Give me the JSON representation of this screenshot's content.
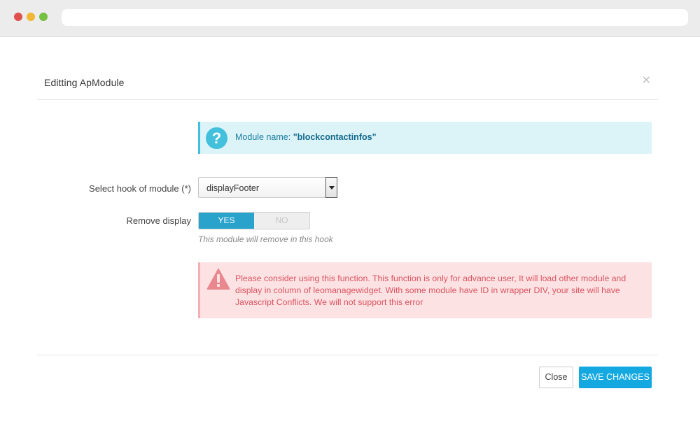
{
  "modal": {
    "title": "Editting ApModule",
    "close_glyph": "×"
  },
  "info_alert": {
    "icon": "question-icon",
    "icon_glyph": "?",
    "prefix": "Module name: ",
    "module_name": "\"blockcontactinfos\""
  },
  "form": {
    "hook_label": "Select hook of module (*)",
    "hook_value": "displayFooter",
    "remove_label": "Remove display",
    "toggle_yes": "YES",
    "toggle_no": "NO",
    "toggle_selected": "YES",
    "help_text": "This module will remove in this hook"
  },
  "danger_alert": {
    "icon": "warning-icon",
    "text": "Please consider using this function. This function is only for advance user, It will load other module and display in column of leomanagewidget. With some module have ID in wrapper DIV, your site will have Javascript Conflicts. We will not support this error"
  },
  "footer": {
    "close_label": "Close",
    "save_label": "SAVE CHANGES"
  },
  "colors": {
    "accent": "#2aa3cc",
    "save": "#13a9e0",
    "info_bg": "#dcf3f8",
    "danger_bg": "#fde2e4",
    "danger_text": "#d9545f"
  }
}
